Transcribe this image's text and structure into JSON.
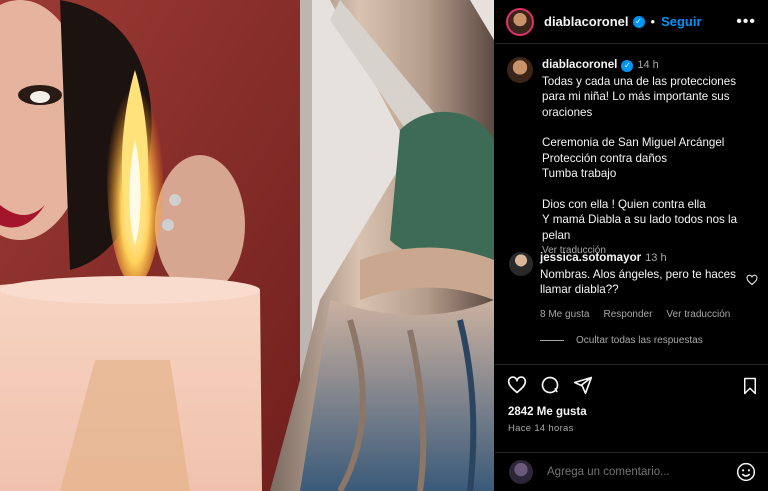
{
  "post": {
    "username": "diablacoronel",
    "follow_label": "Seguir",
    "more_label": "•••"
  },
  "caption": {
    "username": "diablacoronel",
    "time": "14 h",
    "lines1": "Todas y cada una de las protecciones para mi niña! Lo más importante sus oraciones",
    "line2a": "Ceremonia de San Miguel Arcángel",
    "line2b": "Protección contra daños",
    "line2c": "Tumba trabajo",
    "line3a": "Dios con ella ! Quien contra ella",
    "line3b": "Y mamá Diabla a su lado todos nos la pelan",
    "see_translation": "Ver traducción"
  },
  "comment": {
    "username": "jessica.sotomayor",
    "time": "13 h",
    "text": "Nombras. Alos ángeles, pero te haces llamar diabla??",
    "likes": "8 Me gusta",
    "reply": "Responder",
    "see_translation": "Ver traducción",
    "hide_replies": "Ocultar todas las respuestas"
  },
  "actions": {
    "likes": "2842 Me gusta",
    "time": "Hace 14 horas"
  },
  "add_comment": {
    "placeholder": "Agrega un comentario..."
  },
  "colors": {
    "accent": "#0095f6",
    "background": "#000000",
    "secondary_text": "#a8a8a8"
  },
  "icons": [
    "heart-icon",
    "comment-icon",
    "share-icon",
    "bookmark-icon",
    "emoji-icon",
    "verified-icon",
    "more-icon"
  ]
}
